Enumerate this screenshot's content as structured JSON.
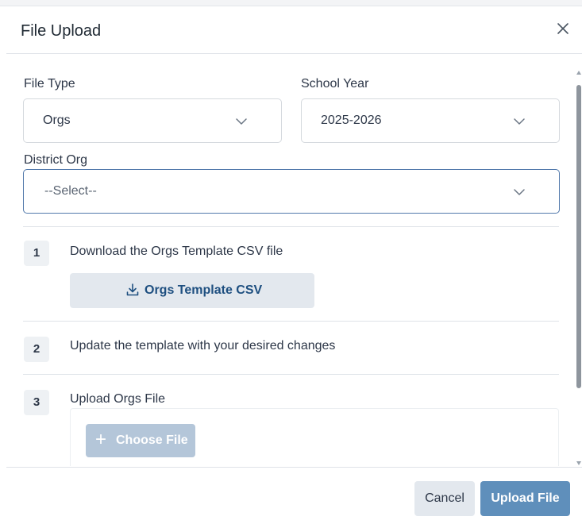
{
  "dialog": {
    "title": "File Upload",
    "close_icon": "close-icon"
  },
  "form": {
    "file_type": {
      "label": "File Type",
      "value": "Orgs"
    },
    "school_year": {
      "label": "School Year",
      "value": "2025-2026"
    },
    "district_org": {
      "label": "District Org",
      "value": "--Select--"
    },
    "dropdown_icon": "chevron-down-icon"
  },
  "steps": [
    {
      "number": "1",
      "text": "Download the Orgs Template CSV file"
    },
    {
      "number": "2",
      "text": "Update the template with your desired changes"
    },
    {
      "number": "3",
      "text": "Upload Orgs File"
    }
  ],
  "template_button": {
    "label": "Orgs Template CSV",
    "icon": "download-icon"
  },
  "choose_file_button": {
    "label": "Choose File",
    "icon": "plus-icon"
  },
  "footer": {
    "cancel_label": "Cancel",
    "upload_label": "Upload File"
  },
  "colors": {
    "primary": "#5f8fbb",
    "primary_disabled": "#b4c6d9",
    "link_text": "#1e4f80",
    "secondary_bg": "#e3e8ee",
    "focus_border": "#5279ab"
  }
}
